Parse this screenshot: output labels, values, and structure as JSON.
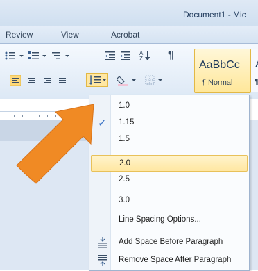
{
  "window": {
    "title": "Document1 - Mic"
  },
  "tabs": [
    {
      "label": "Review"
    },
    {
      "label": "View"
    },
    {
      "label": "Acrobat"
    }
  ],
  "styles": {
    "sample": "AaBbCc",
    "name": "¶ Normal",
    "partial": "¶",
    "partial2": "A"
  },
  "menu": {
    "items": [
      {
        "label": "1.0"
      },
      {
        "label": "1.15"
      },
      {
        "label": "1.5"
      },
      {
        "label": "2.0"
      },
      {
        "label": "2.5"
      },
      {
        "label": "3.0"
      },
      {
        "label": "Line Spacing Options..."
      },
      {
        "label": "Add Space Before Paragraph"
      },
      {
        "label": "Remove Space After Paragraph"
      }
    ]
  },
  "colors": {
    "accent_orange": "#f08a24",
    "highlight": "#ffe7a2",
    "check": "#3a73c6"
  },
  "icons": {
    "check": "✓"
  }
}
